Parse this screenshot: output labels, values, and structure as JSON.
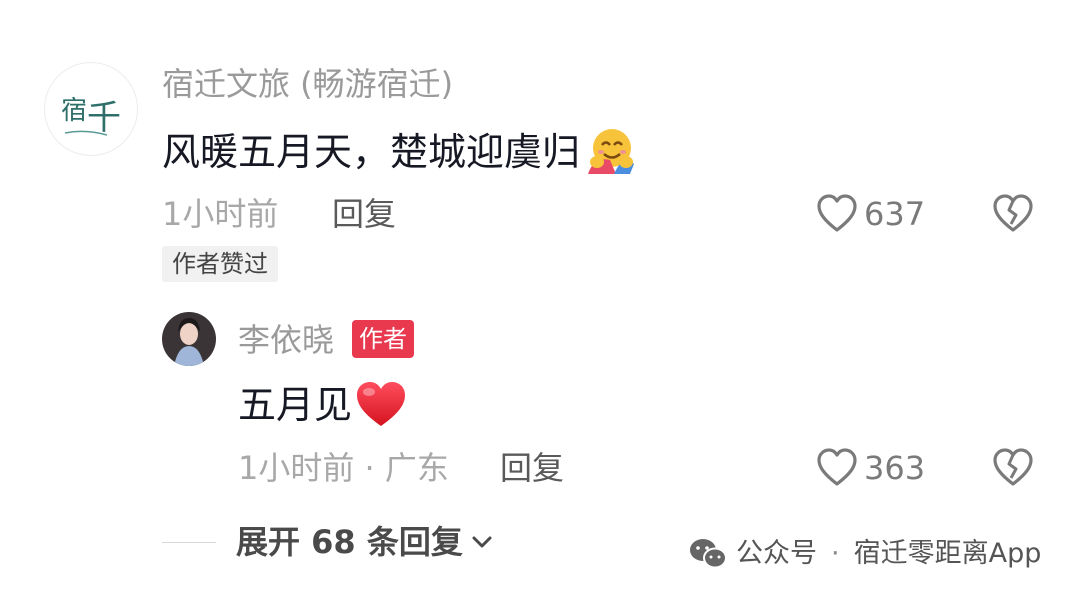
{
  "main_comment": {
    "username": "宿迁文旅 (畅游宿迁)",
    "avatar_text": "宿迁",
    "text": "风暖五月天，楚城迎虞归",
    "emoji": "hugging-face-emoji",
    "time": "1小时前",
    "reply_label": "回复",
    "like_count": "637",
    "badge": "作者赞过"
  },
  "reply_comment": {
    "username": "李依晓",
    "tag": "作者",
    "text": "五月见",
    "emoji": "red-heart-emoji",
    "meta": "1小时前 · 广东",
    "reply_label": "回复",
    "like_count": "363"
  },
  "expand": {
    "label": "展开 68 条回复"
  },
  "watermark": {
    "part1": "公众号",
    "separator": "·",
    "part2": "宿迁零距离App"
  },
  "colors": {
    "author_tag": "#e8394f",
    "text_primary": "#161823",
    "text_secondary": "#9a9a9a"
  }
}
